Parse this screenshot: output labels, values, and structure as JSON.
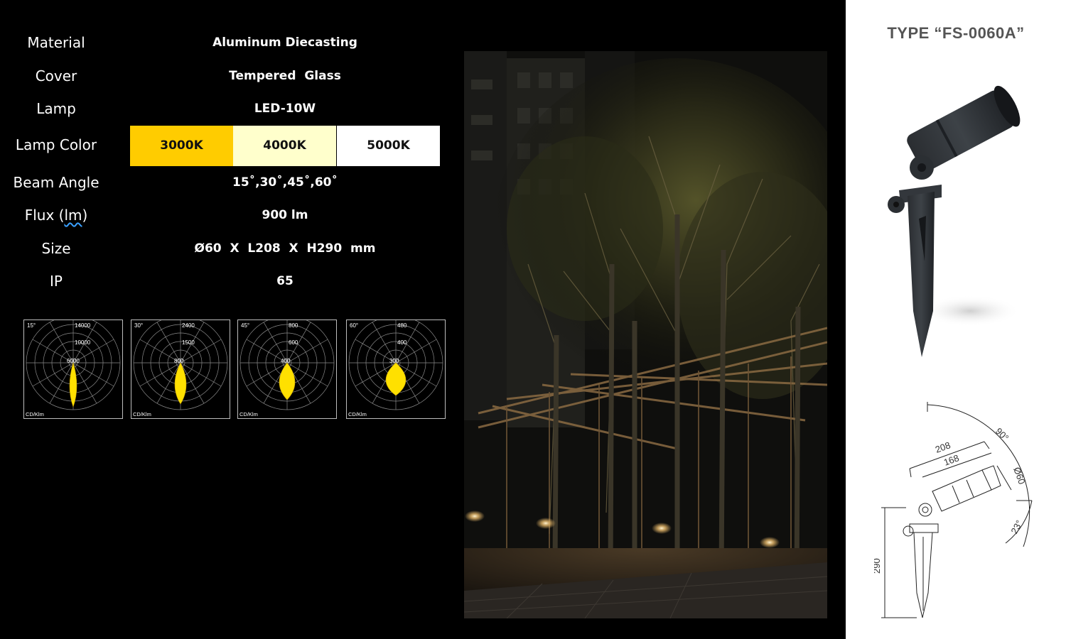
{
  "specs": {
    "material": {
      "label": "Material",
      "value": "Aluminum Diecasting"
    },
    "cover": {
      "label": "Cover",
      "value": "Tempered  Glass"
    },
    "lamp": {
      "label": "Lamp",
      "value": "LED-10W"
    },
    "lamp_color": {
      "label": "Lamp Color",
      "options": [
        {
          "label": "3000K",
          "color": "#ffcc00"
        },
        {
          "label": "4000K",
          "color": "#ffffcc"
        },
        {
          "label": "5000K",
          "color": "#ffffff"
        }
      ]
    },
    "beam_angle": {
      "label": "Beam Angle",
      "value": "15˚,30˚,45˚,60˚"
    },
    "flux": {
      "label_prefix": "Flux (",
      "label_unit": "lm",
      "label_suffix": ")",
      "value": "900 lm"
    },
    "size": {
      "label": "Size",
      "value": "Ø60  X  L208  X  H290  mm"
    },
    "ip": {
      "label": "IP",
      "value": "65"
    }
  },
  "polar_charts": [
    {
      "angle": "15°",
      "rings": [
        "14000",
        "10000",
        "6000"
      ],
      "unit": "CD/Klm"
    },
    {
      "angle": "30°",
      "rings": [
        "2400",
        "1500",
        "800"
      ],
      "unit": "CD/Klm"
    },
    {
      "angle": "45°",
      "rings": [
        "800",
        "600",
        "400"
      ],
      "unit": "CD/Klm"
    },
    {
      "angle": "60°",
      "rings": [
        "480",
        "400",
        "300"
      ],
      "unit": "CD/Klm"
    }
  ],
  "product": {
    "type_title": "TYPE “FS-0060A”"
  },
  "dimensions": {
    "length_overall": "208",
    "length_body": "168",
    "diameter": "Ø60",
    "tilt_angle": "90°",
    "down_angle": "23°",
    "height": "290"
  },
  "colors": {
    "accent_yellow": "#ffcc00",
    "background": "#000000",
    "panel": "#ffffff"
  }
}
